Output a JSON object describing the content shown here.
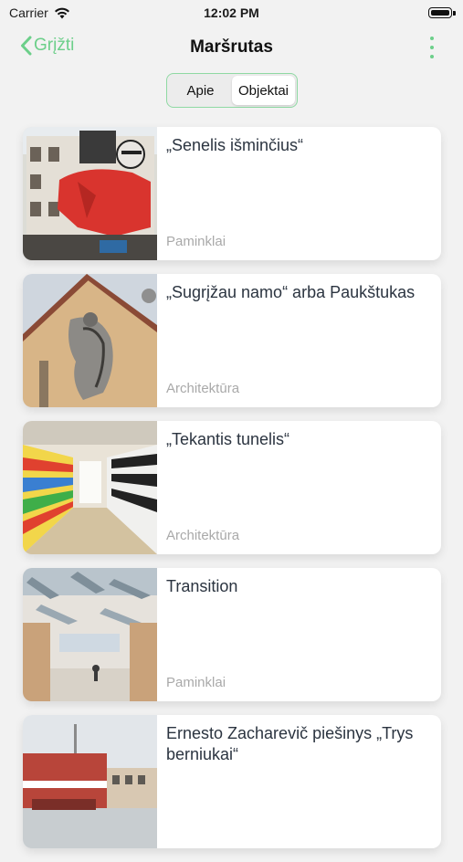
{
  "status_bar": {
    "carrier": "Carrier",
    "time": "12:02 PM"
  },
  "nav": {
    "back_label": "Grįžti",
    "title": "Maršrutas"
  },
  "segments": [
    {
      "label": "Apie",
      "active": false
    },
    {
      "label": "Objektai",
      "active": true
    }
  ],
  "items": [
    {
      "title": "„Senelis išminčius“",
      "category": "Paminklai"
    },
    {
      "title": "„Sugrįžau namo“ arba Paukštukas",
      "category": "Architektūra"
    },
    {
      "title": "„Tekantis tunelis“",
      "category": "Architektūra"
    },
    {
      "title": "Transition",
      "category": "Paminklai"
    },
    {
      "title": "Ernesto Zacharevič piešinys „Trys berniukai“",
      "category": ""
    }
  ],
  "colors": {
    "accent": "#6ccf8a",
    "background": "#f2f2f2"
  }
}
